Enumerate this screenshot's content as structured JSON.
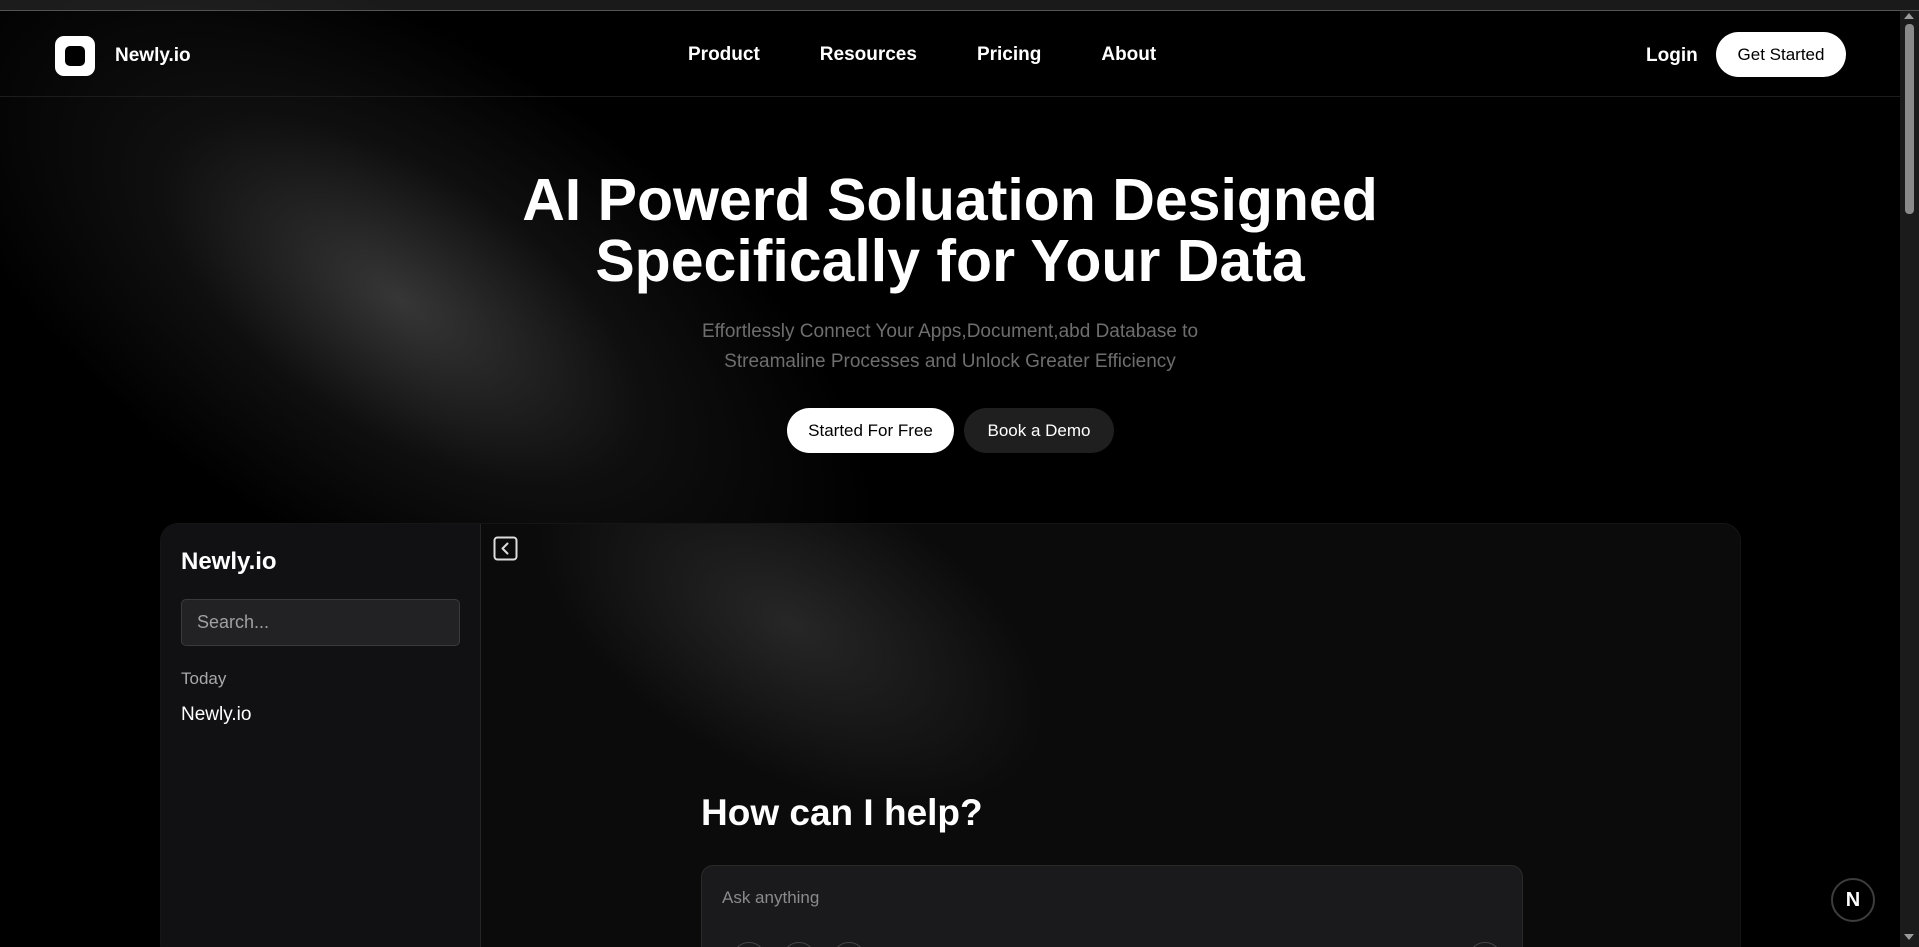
{
  "nav": {
    "brand": "Newly.io",
    "links": [
      "Product",
      "Resources",
      "Pricing",
      "About"
    ],
    "login": "Login",
    "get_started": "Get Started"
  },
  "hero": {
    "title_line1": "AI Powerd Soluation Designed",
    "title_line2": "Specifically for Your Data",
    "subtitle_line1": "Effortlessly Connect Your Apps,Document,abd Database to",
    "subtitle_line2": "Streamaline Processes and Unlock Greater Efficiency",
    "primary_button": "Started For Free",
    "secondary_button": "Book a Demo"
  },
  "app": {
    "sidebar_brand": "Newly.io",
    "search_placeholder": "Search...",
    "section_label": "Today",
    "chat_items": [
      "Newly.io"
    ],
    "heading": "How can I help?",
    "ask_placeholder": "Ask anything"
  },
  "badge": "N",
  "icons": {
    "logo": "logo-icon",
    "collapse": "collapse-sidebar-icon"
  }
}
